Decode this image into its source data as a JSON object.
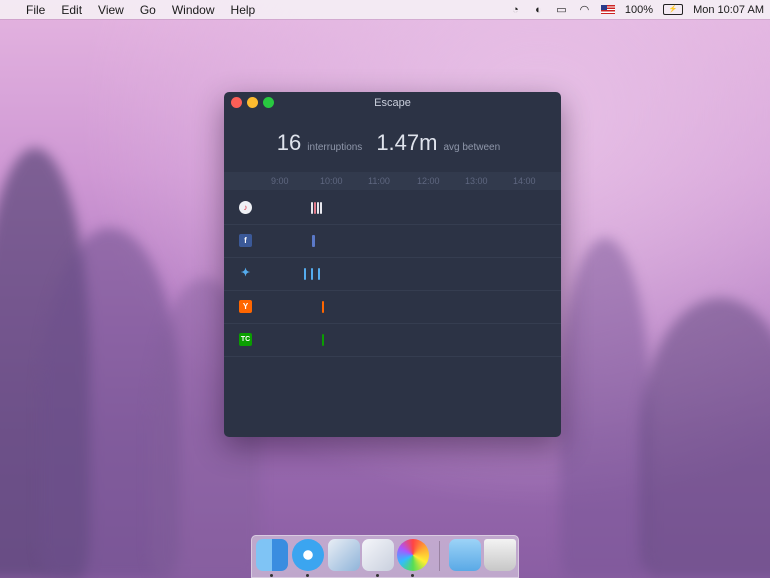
{
  "menubar": {
    "items": [
      "File",
      "Edit",
      "View",
      "Go",
      "Window",
      "Help"
    ],
    "battery": "100%",
    "clock": "Mon 10:07 AM"
  },
  "window": {
    "title": "Escape",
    "interruptions_count": "16",
    "interruptions_label": "interruptions",
    "avg_value": "1.47m",
    "avg_label": "avg between",
    "ticks": [
      "9:00",
      "10:00",
      "11:00",
      "12:00",
      "13:00",
      "14:00"
    ],
    "rows": [
      {
        "app": "itunes-icon",
        "color": "#e8e8ee"
      },
      {
        "app": "facebook-icon",
        "color": "#3b5998"
      },
      {
        "app": "twitter-icon",
        "color": "#55acee"
      },
      {
        "app": "hacker-news-icon",
        "color": "#ff6600"
      },
      {
        "app": "techcrunch-icon",
        "color": "#0a9e01"
      }
    ]
  },
  "dock": {
    "apps": [
      "finder-icon",
      "safari-icon",
      "preview-icon",
      "escape-app-icon",
      "photos-icon",
      "folder-icon",
      "trash-icon"
    ]
  }
}
